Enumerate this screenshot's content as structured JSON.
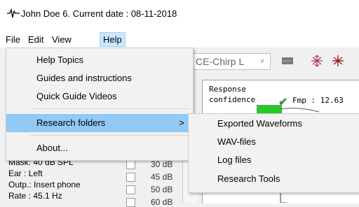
{
  "window": {
    "title": "John Doe 6. Current date : 08-11-2018"
  },
  "menubar": {
    "items": [
      "File",
      "Edit",
      "View",
      "Help"
    ]
  },
  "help_menu": {
    "items": [
      "Help Topics",
      "Guides and instructions",
      "Quick Guide Videos",
      "Research folders",
      "About..."
    ],
    "submenu_arrow": ">"
  },
  "research_submenu": {
    "items": [
      "Exported Waveforms",
      "WAV-files",
      "Log files",
      "Research Tools"
    ]
  },
  "toolbar": {
    "stimulus_value": "CE-Chirp L",
    "dropdown_arrow": "∨"
  },
  "response_panel": {
    "label_line1": "Response",
    "label_line2": "confidence",
    "check_mark": "✔",
    "fmp_text": "Fmp : 12.63"
  },
  "left_info": {
    "mask": "Mask:  40 dB SPL",
    "ear": "Ear :  Left",
    "output": "Outp.: Insert phone",
    "rate": "Rate : 45.1 Hz"
  },
  "levels": [
    "30 dB",
    "45 dB",
    "50 dB",
    "60 dB"
  ],
  "colors": {
    "highlight": "#91c9f7",
    "menu_active": "#cce8ff",
    "confidence_green": "#22cc22"
  }
}
